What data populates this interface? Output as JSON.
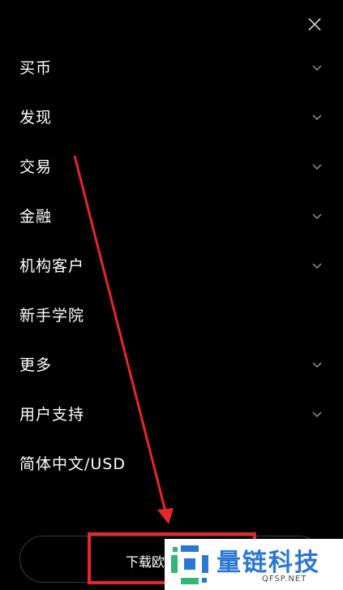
{
  "menu": {
    "items": [
      {
        "label": "买币",
        "has_chevron": true
      },
      {
        "label": "发现",
        "has_chevron": true
      },
      {
        "label": "交易",
        "has_chevron": true
      },
      {
        "label": "金融",
        "has_chevron": true
      },
      {
        "label": "机构客户",
        "has_chevron": true
      },
      {
        "label": "新手学院",
        "has_chevron": false
      },
      {
        "label": "更多",
        "has_chevron": true
      },
      {
        "label": "用户支持",
        "has_chevron": true
      },
      {
        "label": "简体中文/USD",
        "has_chevron": false
      }
    ]
  },
  "bottom": {
    "download_label": "下载欧"
  },
  "watermark": {
    "title": "量链科技",
    "subtitle": "QFSP.NET"
  },
  "colors": {
    "background": "#000000",
    "annotation_red": "#e8262a",
    "watermark_blue": "#2a77d6",
    "watermark_green": "#2fb873"
  },
  "icons": {
    "close": "close-icon",
    "chevron": "chevron-down-icon"
  }
}
